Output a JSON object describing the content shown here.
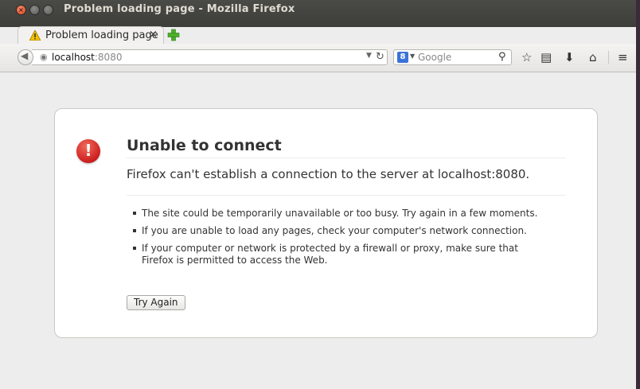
{
  "window": {
    "title": "Problem loading page - Mozilla Firefox"
  },
  "tabs": [
    {
      "label": "Problem loading page",
      "icon": "warning-icon",
      "close_glyph": "×"
    }
  ],
  "toolbar": {
    "url_host": "localhost",
    "url_port": ":8080",
    "search_engine_glyph": "8",
    "search_placeholder": "Google",
    "icons": [
      "back-icon",
      "globe-icon",
      "reload-icon",
      "search-icon",
      "bookmark-star-icon",
      "bookmarks-menu-icon",
      "download-icon",
      "home-icon",
      "menu-icon"
    ]
  },
  "error": {
    "title": "Unable to connect",
    "description": "Firefox can't establish a connection to the server at localhost:8080.",
    "tips": [
      "The site could be temporarily unavailable or too busy. Try again in a few moments.",
      "If you are unable to load any pages, check your computer's network connection.",
      "If your computer or network is protected by a firewall or proxy, make sure that Firefox is permitted to access the Web."
    ],
    "button_label": "Try Again",
    "icon": "error-icon",
    "accent_color": "#cc1f1f"
  }
}
